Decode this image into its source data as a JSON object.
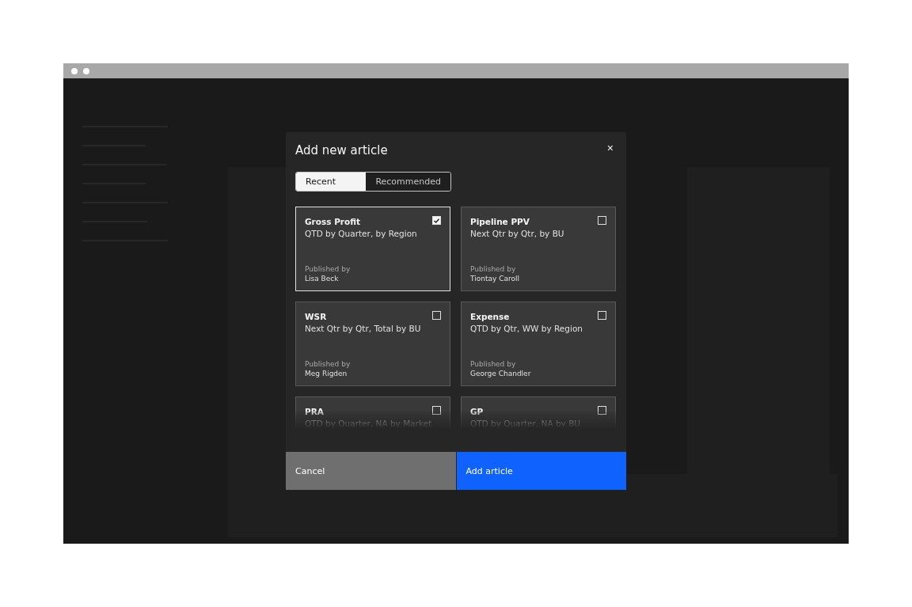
{
  "dialog": {
    "title": "Add new article",
    "close": "×",
    "tabs": [
      {
        "label": "Recent",
        "selected": true
      },
      {
        "label": "Recommended",
        "selected": false
      }
    ],
    "articles": [
      {
        "title": "Gross Profit",
        "subtitle": "QTD by Quarter, by Region",
        "published_label": "Published by",
        "author": "Lisa Beck",
        "checked": true
      },
      {
        "title": "Pipeline PPV",
        "subtitle": "Next Qtr by Qtr, by BU",
        "published_label": "Published by",
        "author": "Tiontay Caroll",
        "checked": false
      },
      {
        "title": "WSR",
        "subtitle": "Next Qtr by Qtr, Total by BU",
        "published_label": "Published by",
        "author": "Meg Rigden",
        "checked": false
      },
      {
        "title": "Expense",
        "subtitle": "QTD by Qtr, WW by Region",
        "published_label": "Published by",
        "author": "George Chandler",
        "checked": false
      },
      {
        "title": "PRA",
        "subtitle": "QTD by Quarter, NA by Market",
        "checked": false
      },
      {
        "title": "GP",
        "subtitle": "QTD by Quarter, NA by BU",
        "checked": false
      }
    ],
    "buttons": [
      {
        "kind": "secondary",
        "label": "Cancel"
      },
      {
        "kind": "primary",
        "label": "Add article"
      }
    ]
  }
}
